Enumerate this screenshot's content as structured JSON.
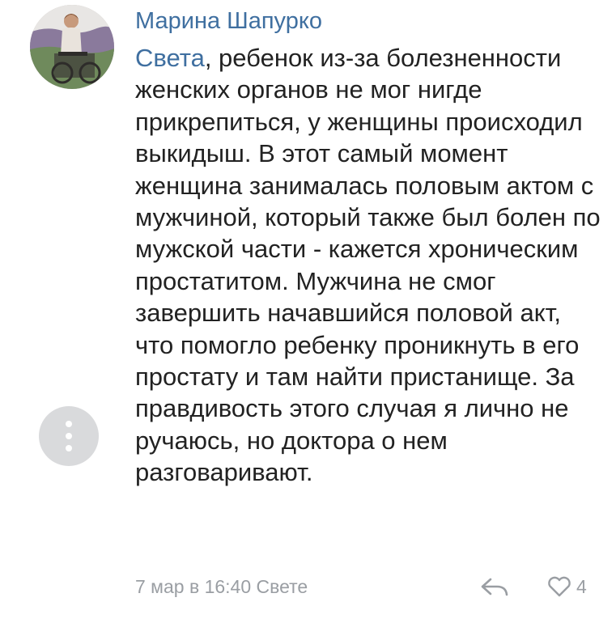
{
  "comment": {
    "author": "Марина Шапурко",
    "mention": "Света",
    "text": ", ребенок из-за болезненности женских органов не мог нигде прикрепиться, у женщины происходил выкидыш. В этот самый момент женщина занималась половым актом с мужчиной, который также был болен по мужской части - кажется хроническим простатитом. Мужчина не смог завершить начавшийся половой акт, что помогло ребенку проникнуть в его простату и там найти пристанище. За правдивость этого случая я лично не ручаюсь, но доктора о нем разговаривают.",
    "date": "7 мар в 16:40",
    "reply_to": "Свете",
    "likes": "4"
  },
  "icons": {
    "more": "more-dots-icon",
    "reply": "reply-arrow-icon",
    "like": "heart-icon"
  },
  "colors": {
    "link": "#3f6fa0",
    "text": "#222222",
    "meta": "#9a9ea3",
    "menu_bg": "#d9dadc"
  }
}
